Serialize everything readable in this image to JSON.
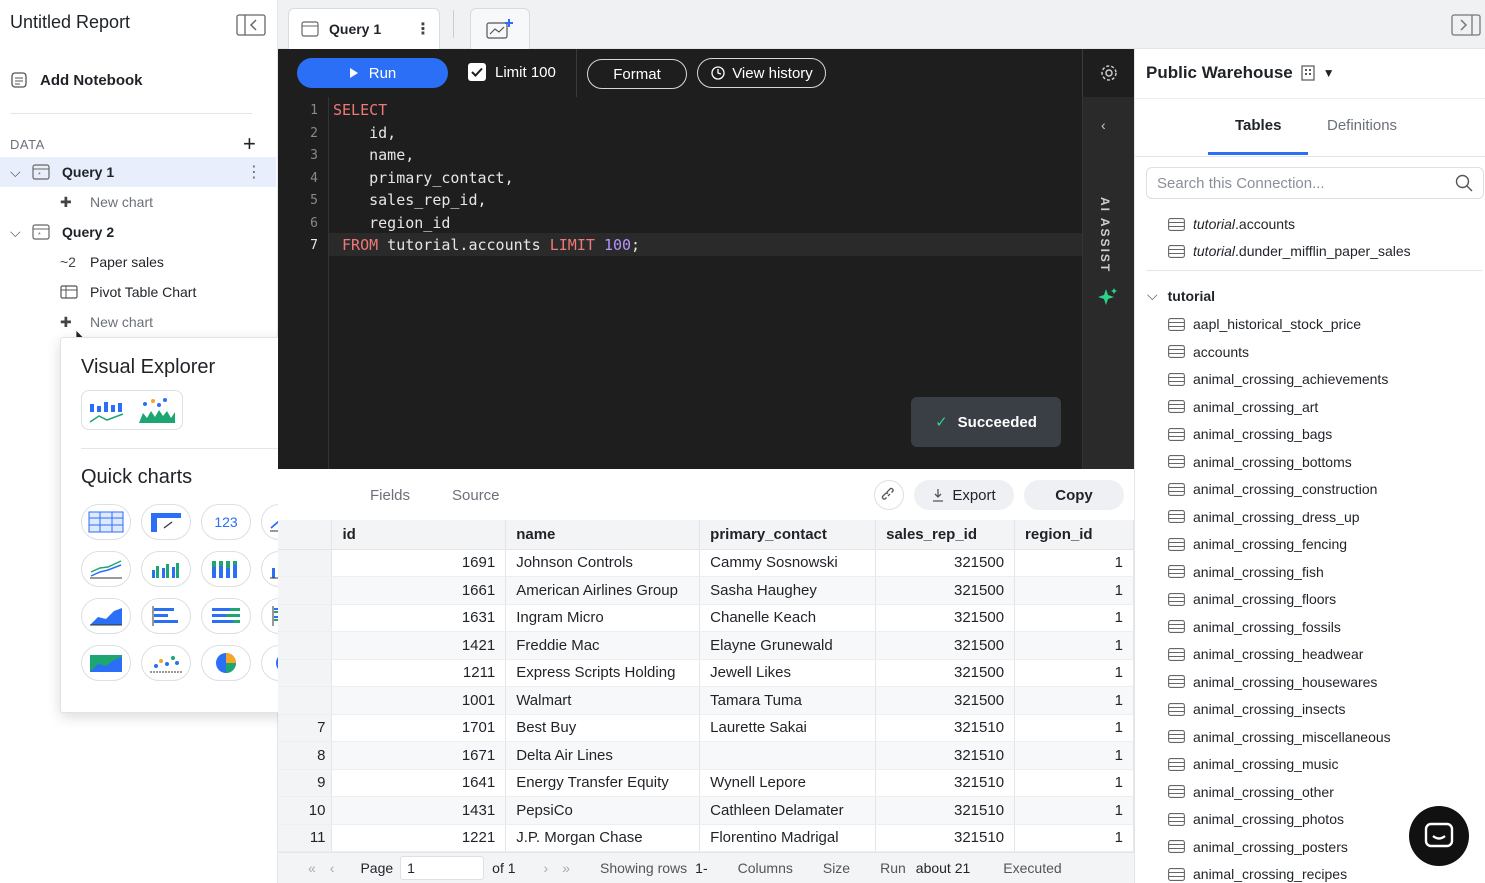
{
  "sidebar": {
    "report_title": "Untitled Report",
    "add_notebook": "Add Notebook",
    "data_label": "DATA",
    "queries": [
      {
        "label": "Query 1",
        "children": [
          {
            "label": "New chart",
            "muted": true
          }
        ]
      },
      {
        "label": "Query 2",
        "children": [
          {
            "label": "Paper sales",
            "icon": "~2"
          },
          {
            "label": "Pivot Table Chart"
          },
          {
            "label": "New chart",
            "muted": true
          }
        ]
      }
    ]
  },
  "popover": {
    "visual_explorer": "Visual Explorer",
    "quick_charts": "Quick charts",
    "big_number_label": "123"
  },
  "tabs": {
    "query_tab": "Query 1"
  },
  "toolbar": {
    "run": "Run",
    "limit": "Limit 100",
    "format": "Format",
    "view_history": "View history"
  },
  "editor": {
    "line_numbers": [
      "1",
      "2",
      "3",
      "4",
      "5",
      "6",
      "7"
    ],
    "ai_assist": "AI ASSIST",
    "toast": "Succeeded"
  },
  "results": {
    "tabs": [
      "Fields",
      "Source"
    ],
    "export": "Export",
    "copy": "Copy",
    "columns": [
      "id",
      "name",
      "primary_contact",
      "sales_rep_id",
      "region_id"
    ],
    "rows": [
      {
        "n": "",
        "id": "1691",
        "name": "Johnson Controls",
        "contact": "Cammy Sosnowski",
        "rep": "321500",
        "region": "1"
      },
      {
        "n": "",
        "id": "1661",
        "name": "American Airlines Group",
        "contact": "Sasha Haughey",
        "rep": "321500",
        "region": "1"
      },
      {
        "n": "",
        "id": "1631",
        "name": "Ingram Micro",
        "contact": "Chanelle Keach",
        "rep": "321500",
        "region": "1"
      },
      {
        "n": "",
        "id": "1421",
        "name": "Freddie Mac",
        "contact": "Elayne Grunewald",
        "rep": "321500",
        "region": "1"
      },
      {
        "n": "",
        "id": "1211",
        "name": "Express Scripts Holding",
        "contact": "Jewell Likes",
        "rep": "321500",
        "region": "1"
      },
      {
        "n": "",
        "id": "1001",
        "name": "Walmart",
        "contact": "Tamara Tuma",
        "rep": "321500",
        "region": "1"
      },
      {
        "n": "7",
        "id": "1701",
        "name": "Best Buy",
        "contact": "Laurette Sakai",
        "rep": "321510",
        "region": "1"
      },
      {
        "n": "8",
        "id": "1671",
        "name": "Delta Air Lines",
        "contact": "",
        "rep": "321510",
        "region": "1"
      },
      {
        "n": "9",
        "id": "1641",
        "name": "Energy Transfer Equity",
        "contact": "Wynell Lepore",
        "rep": "321510",
        "region": "1"
      },
      {
        "n": "10",
        "id": "1431",
        "name": "PepsiCo",
        "contact": "Cathleen Delamater",
        "rep": "321510",
        "region": "1"
      },
      {
        "n": "11",
        "id": "1221",
        "name": "J.P. Morgan Chase",
        "contact": "Florentino Madrigal",
        "rep": "321510",
        "region": "1"
      }
    ],
    "pager": {
      "page_label": "Page",
      "page_value": "1",
      "of": "of 1",
      "showing": "Showing rows",
      "showing_value": "1-",
      "columns": "Columns",
      "size": "Size",
      "run": "Run",
      "run_value": "about 21",
      "executed": "Executed"
    }
  },
  "right_panel": {
    "warehouse": "Public Warehouse",
    "tabs": [
      "Tables",
      "Definitions"
    ],
    "search_placeholder": "Search this Connection...",
    "pinned": [
      {
        "schema": "tutorial",
        "table": ".accounts"
      },
      {
        "schema": "tutorial",
        "table": ".dunder_mifflin_paper_sales"
      }
    ],
    "schema_name": "tutorial",
    "tables": [
      "aapl_historical_stock_price",
      "accounts",
      "animal_crossing_achievements",
      "animal_crossing_art",
      "animal_crossing_bags",
      "animal_crossing_bottoms",
      "animal_crossing_construction",
      "animal_crossing_dress_up",
      "animal_crossing_fencing",
      "animal_crossing_fish",
      "animal_crossing_floors",
      "animal_crossing_fossils",
      "animal_crossing_headwear",
      "animal_crossing_housewares",
      "animal_crossing_insects",
      "animal_crossing_miscellaneous",
      "animal_crossing_music",
      "animal_crossing_other",
      "animal_crossing_photos",
      "animal_crossing_posters",
      "animal_crossing_recipes"
    ]
  },
  "colors": {
    "accent": "#2b6ff6",
    "editor_bg": "#1e1e1e",
    "keyword": "#f07878",
    "number": "#b792ff"
  }
}
